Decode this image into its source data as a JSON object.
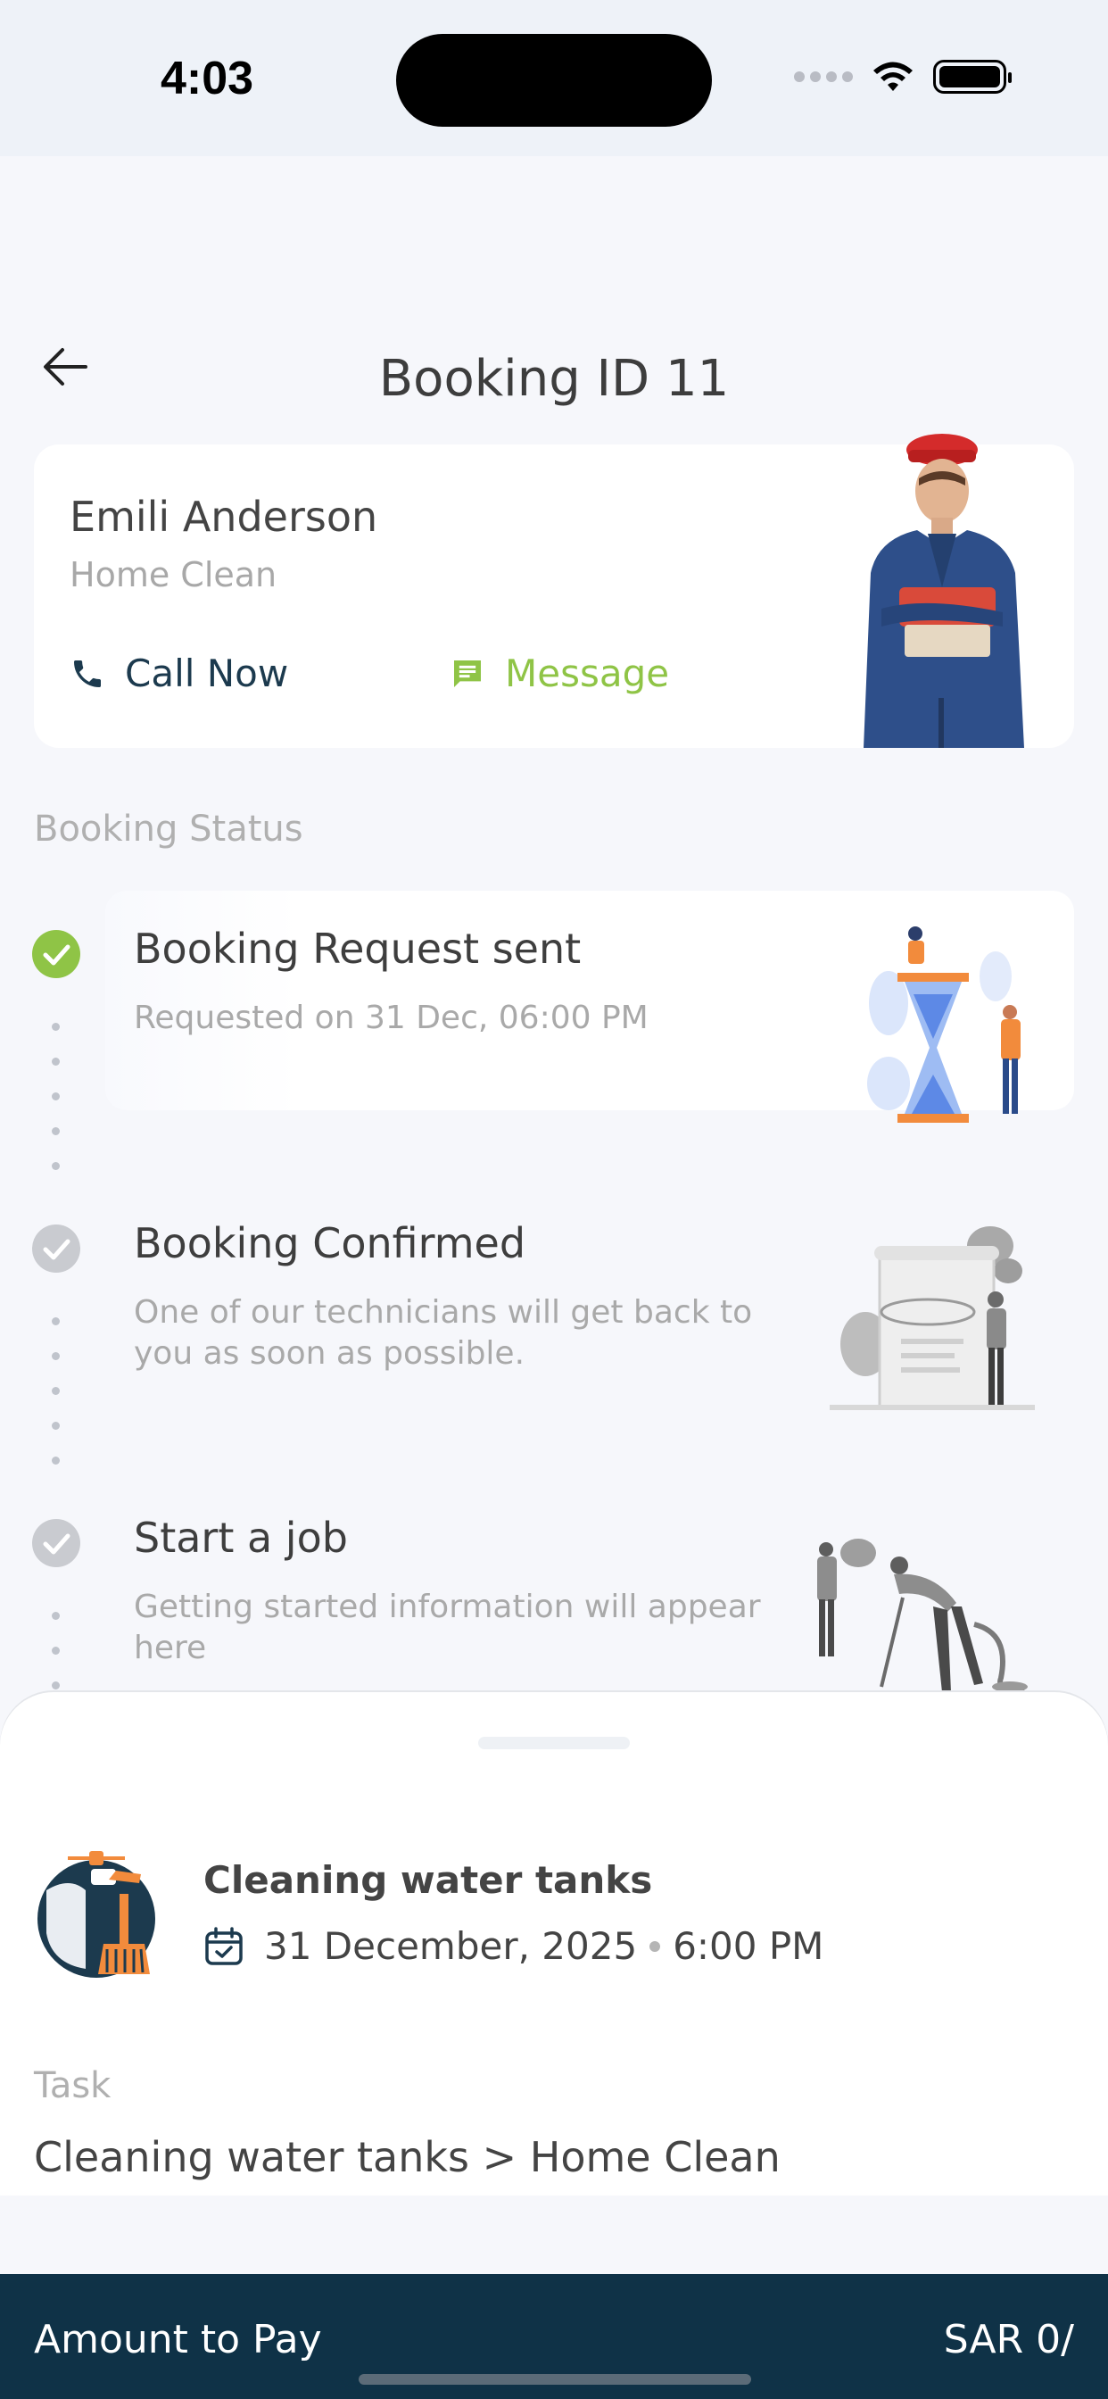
{
  "status_bar": {
    "time": "4:03"
  },
  "header": {
    "title": "Booking ID 11",
    "back_icon": "arrow-left-icon"
  },
  "provider": {
    "name": "Emili Anderson",
    "service": "Home Clean",
    "call_label": "Call Now",
    "message_label": "Message",
    "call_color": "#1c3a4e",
    "message_color": "#8fc446"
  },
  "booking_status": {
    "label": "Booking Status",
    "steps": [
      {
        "title": "Booking Request sent",
        "subtitle": "Requested on 31 Dec, 06:00 PM",
        "state": "done",
        "color": "#8fc446"
      },
      {
        "title": "Booking Confirmed",
        "subtitle": "One of our technicians will get back to you as soon as possible.",
        "state": "pending",
        "color": "#c9cbd0"
      },
      {
        "title": "Start a job",
        "subtitle": "Getting started information will appear here",
        "state": "pending",
        "color": "#c9cbd0"
      }
    ]
  },
  "service_sheet": {
    "title": "Cleaning water tanks",
    "date": "31 December, 2025",
    "time": "6:00 PM",
    "task_label": "Task",
    "task_value": "Cleaning water tanks > Home Clean"
  },
  "payment": {
    "label": "Amount to Pay",
    "amount": "SAR 0/"
  }
}
